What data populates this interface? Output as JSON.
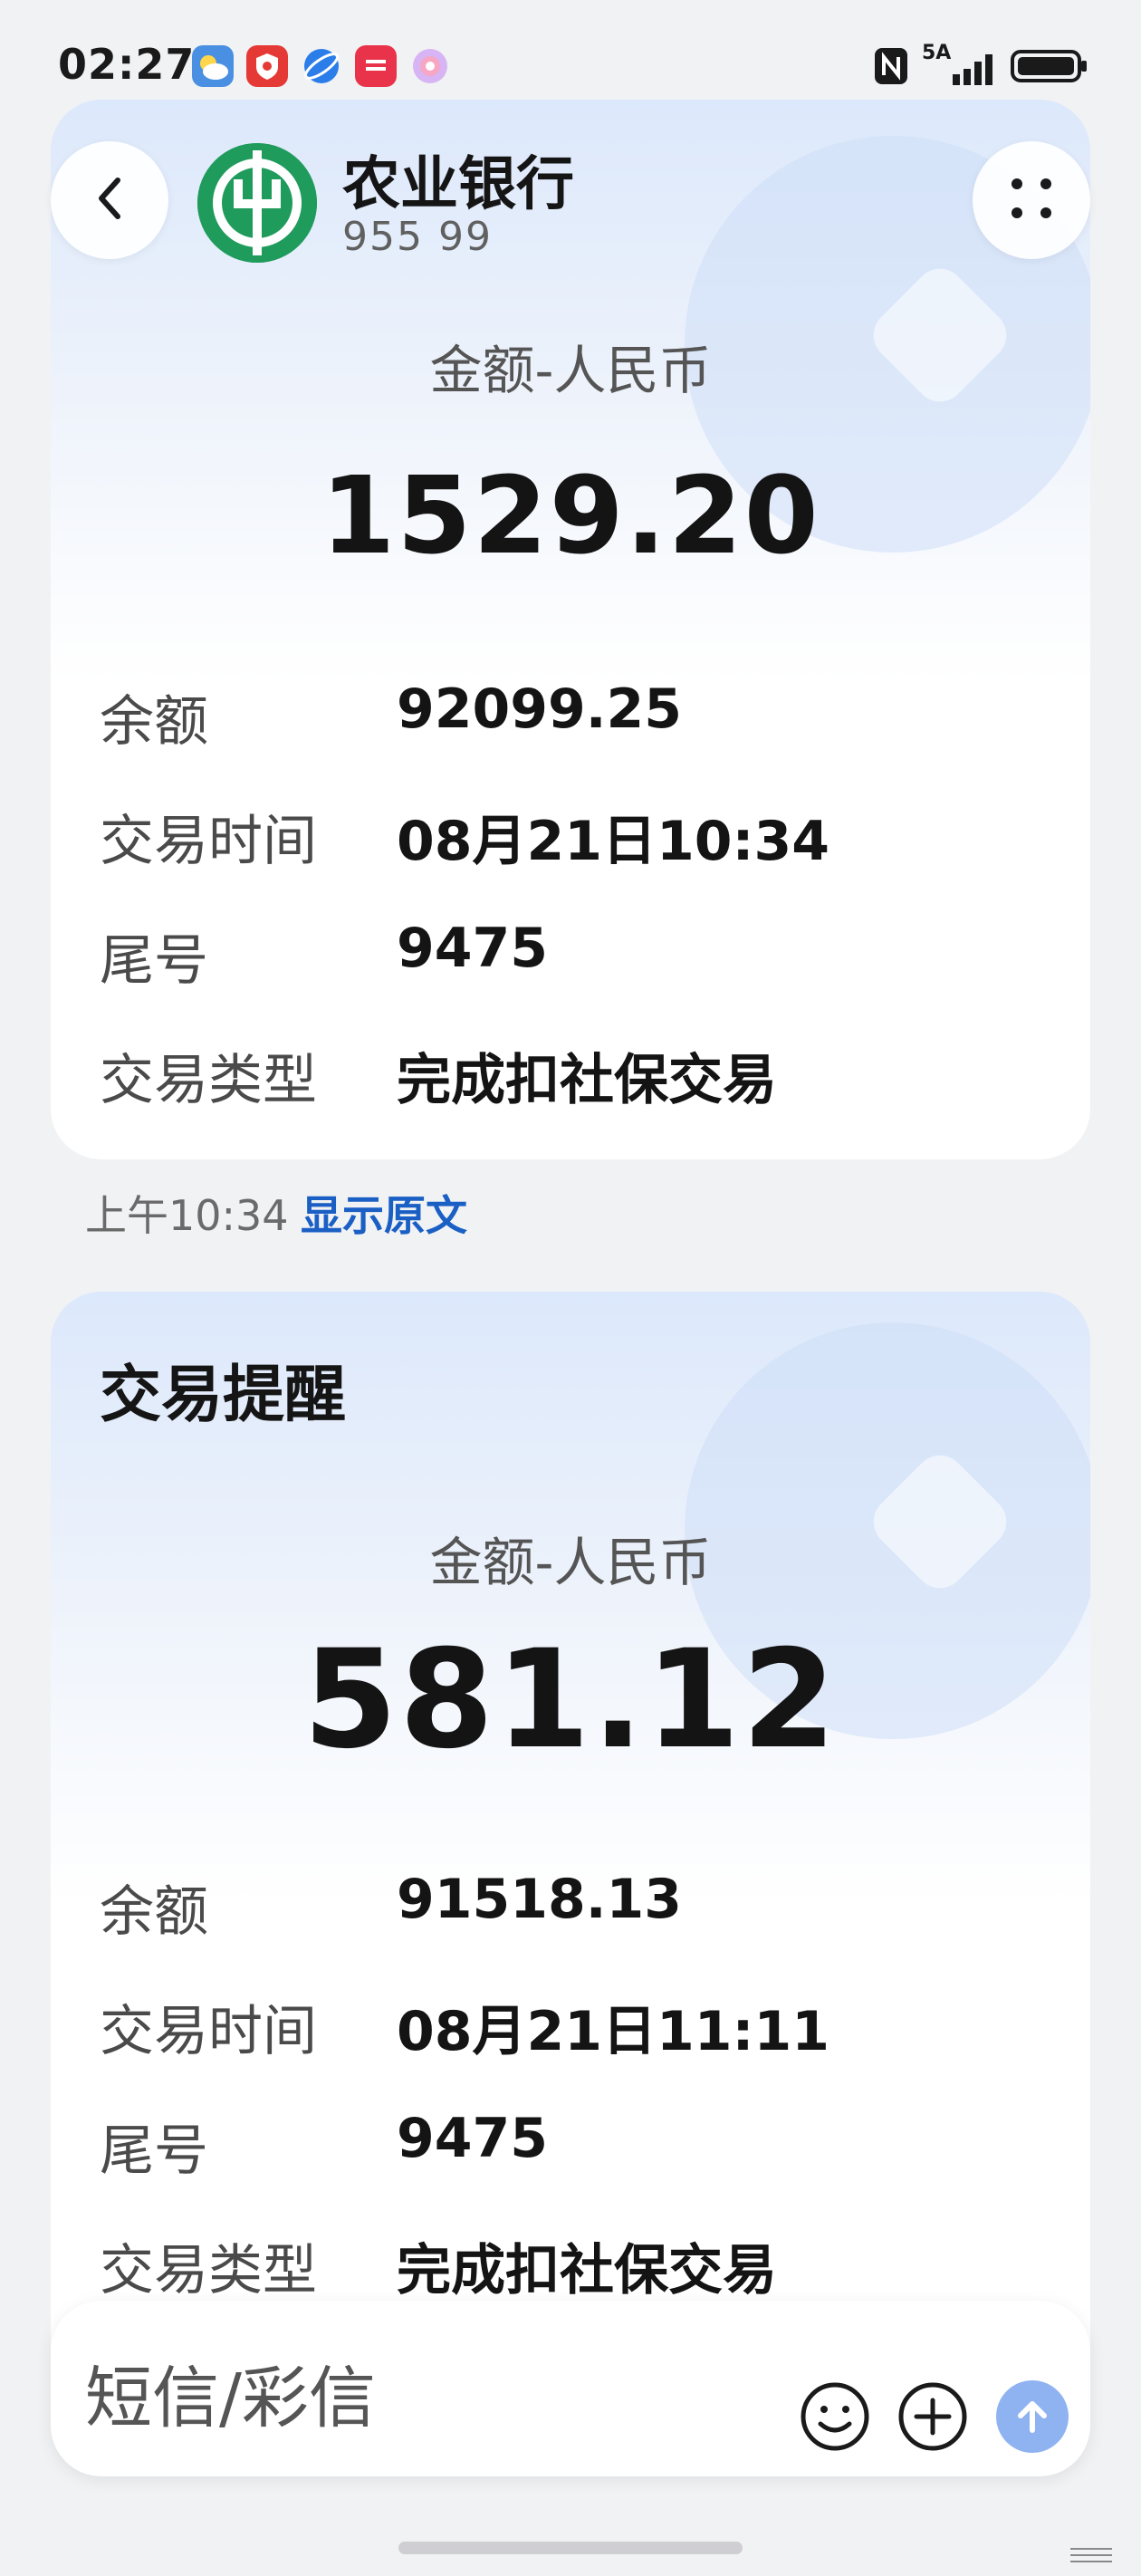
{
  "status_bar": {
    "time": "02:27",
    "network": "5A",
    "icons": [
      "weather-icon",
      "security-app-icon",
      "browser-icon",
      "app-gallery-icon",
      "assistant-icon",
      "nfc-icon",
      "signal-icon",
      "battery-icon"
    ]
  },
  "header": {
    "bank_name": "农业银行",
    "sender_number": "955 99"
  },
  "messages": [
    {
      "title": "",
      "amount_label": "金额-人民币",
      "amount": "1529.20",
      "rows": [
        {
          "label": "余额",
          "value": "92099.25"
        },
        {
          "label": "交易时间",
          "value": "08月21日10:34"
        },
        {
          "label": "尾号",
          "value": "9475"
        },
        {
          "label": "交易类型",
          "value": "完成扣社保交易"
        }
      ],
      "time": "上午10:34",
      "show_original": "显示原文"
    },
    {
      "title": "交易提醒",
      "amount_label": "金额-人民币",
      "amount": "581.12",
      "rows": [
        {
          "label": "余额",
          "value": "91518.13"
        },
        {
          "label": "交易时间",
          "value": "08月21日11:11"
        },
        {
          "label": "尾号",
          "value": "9475"
        },
        {
          "label": "交易类型",
          "value": "完成扣社保交易"
        }
      ]
    }
  ],
  "composer": {
    "placeholder": "短信/彩信"
  },
  "colors": {
    "brand": "#1f9b5c",
    "link": "#1a5fc4",
    "send_button": "#8fb3f1"
  }
}
